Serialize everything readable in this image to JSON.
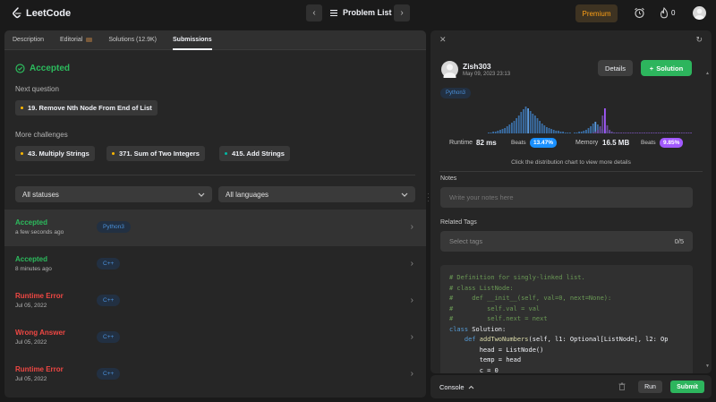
{
  "topnav": {
    "logo_text": "LeetCode",
    "problem_list": "Problem List",
    "premium": "Premium",
    "streak_count": "0"
  },
  "left": {
    "tabs": [
      {
        "label": "Description"
      },
      {
        "label": "Editorial"
      },
      {
        "label": "Solutions (12.9K)"
      },
      {
        "label": "Submissions"
      }
    ],
    "status": "Accepted",
    "next_question_label": "Next question",
    "next_question": {
      "label": "19. Remove Nth Node From End of List",
      "color": "#ffb800"
    },
    "more_challenges_label": "More challenges",
    "challenges": [
      {
        "label": "43. Multiply Strings",
        "color": "#ffb800"
      },
      {
        "label": "371. Sum of Two Integers",
        "color": "#ffb800"
      },
      {
        "label": "415. Add Strings",
        "color": "#00b8a3"
      }
    ],
    "filters": {
      "status": "All statuses",
      "language": "All languages"
    },
    "submissions": [
      {
        "status": "Accepted",
        "time": "a few seconds ago",
        "lang": "Python3",
        "color": "#2cbb5d"
      },
      {
        "status": "Accepted",
        "time": "8 minutes ago",
        "lang": "C++",
        "color": "#2cbb5d"
      },
      {
        "status": "Runtime Error",
        "time": "Jul 05, 2022",
        "lang": "C++",
        "color": "#ef4743"
      },
      {
        "status": "Wrong Answer",
        "time": "Jul 05, 2022",
        "lang": "C++",
        "color": "#ef4743"
      },
      {
        "status": "Runtime Error",
        "time": "Jul 05, 2022",
        "lang": "C++",
        "color": "#ef4743"
      }
    ]
  },
  "right": {
    "user": "Zish303",
    "date": "May 09, 2023 23:13",
    "details_btn": "Details",
    "solution_btn": "Solution",
    "lang": "Python3",
    "runtime_label": "Runtime",
    "runtime_value": "82 ms",
    "runtime_beats_label": "Beats",
    "runtime_beats": "13.47%",
    "memory_label": "Memory",
    "memory_value": "16.5 MB",
    "memory_beats_label": "Beats",
    "memory_beats": "9.85%",
    "chart_hint": "Click the distribution chart to view more details",
    "notes_label": "Notes",
    "notes_placeholder": "Write your notes here",
    "tags_label": "Related Tags",
    "tags_placeholder": "Select tags",
    "tags_count": "0/5",
    "code_lines": [
      {
        "cls": "c-comment",
        "text": "# Definition for singly-linked list."
      },
      {
        "cls": "c-comment",
        "text": "# class ListNode:"
      },
      {
        "cls": "c-comment",
        "text": "#     def __init__(self, val=0, next=None):"
      },
      {
        "cls": "c-comment",
        "text": "#         self.val = val"
      },
      {
        "cls": "c-comment",
        "text": "#         self.next = next"
      },
      {
        "cls": "",
        "text": "class Solution:"
      },
      {
        "cls": "",
        "text": "    def addTwoNumbers(self, l1: Optional[ListNode], l2: Op"
      },
      {
        "cls": "",
        "text": "        head = ListNode()"
      },
      {
        "cls": "",
        "text": "        temp = head"
      },
      {
        "cls": "",
        "text": "        c = 0"
      }
    ]
  },
  "console": {
    "label": "Console",
    "run": "Run",
    "submit": "Submit"
  },
  "colors": {
    "accent_green": "#2db55d",
    "accepted": "#2cbb5d",
    "error": "#ef4743",
    "premium": "#ffa116",
    "runtime_pill": "#1a90ff",
    "memory_pill": "#a259ff"
  }
}
